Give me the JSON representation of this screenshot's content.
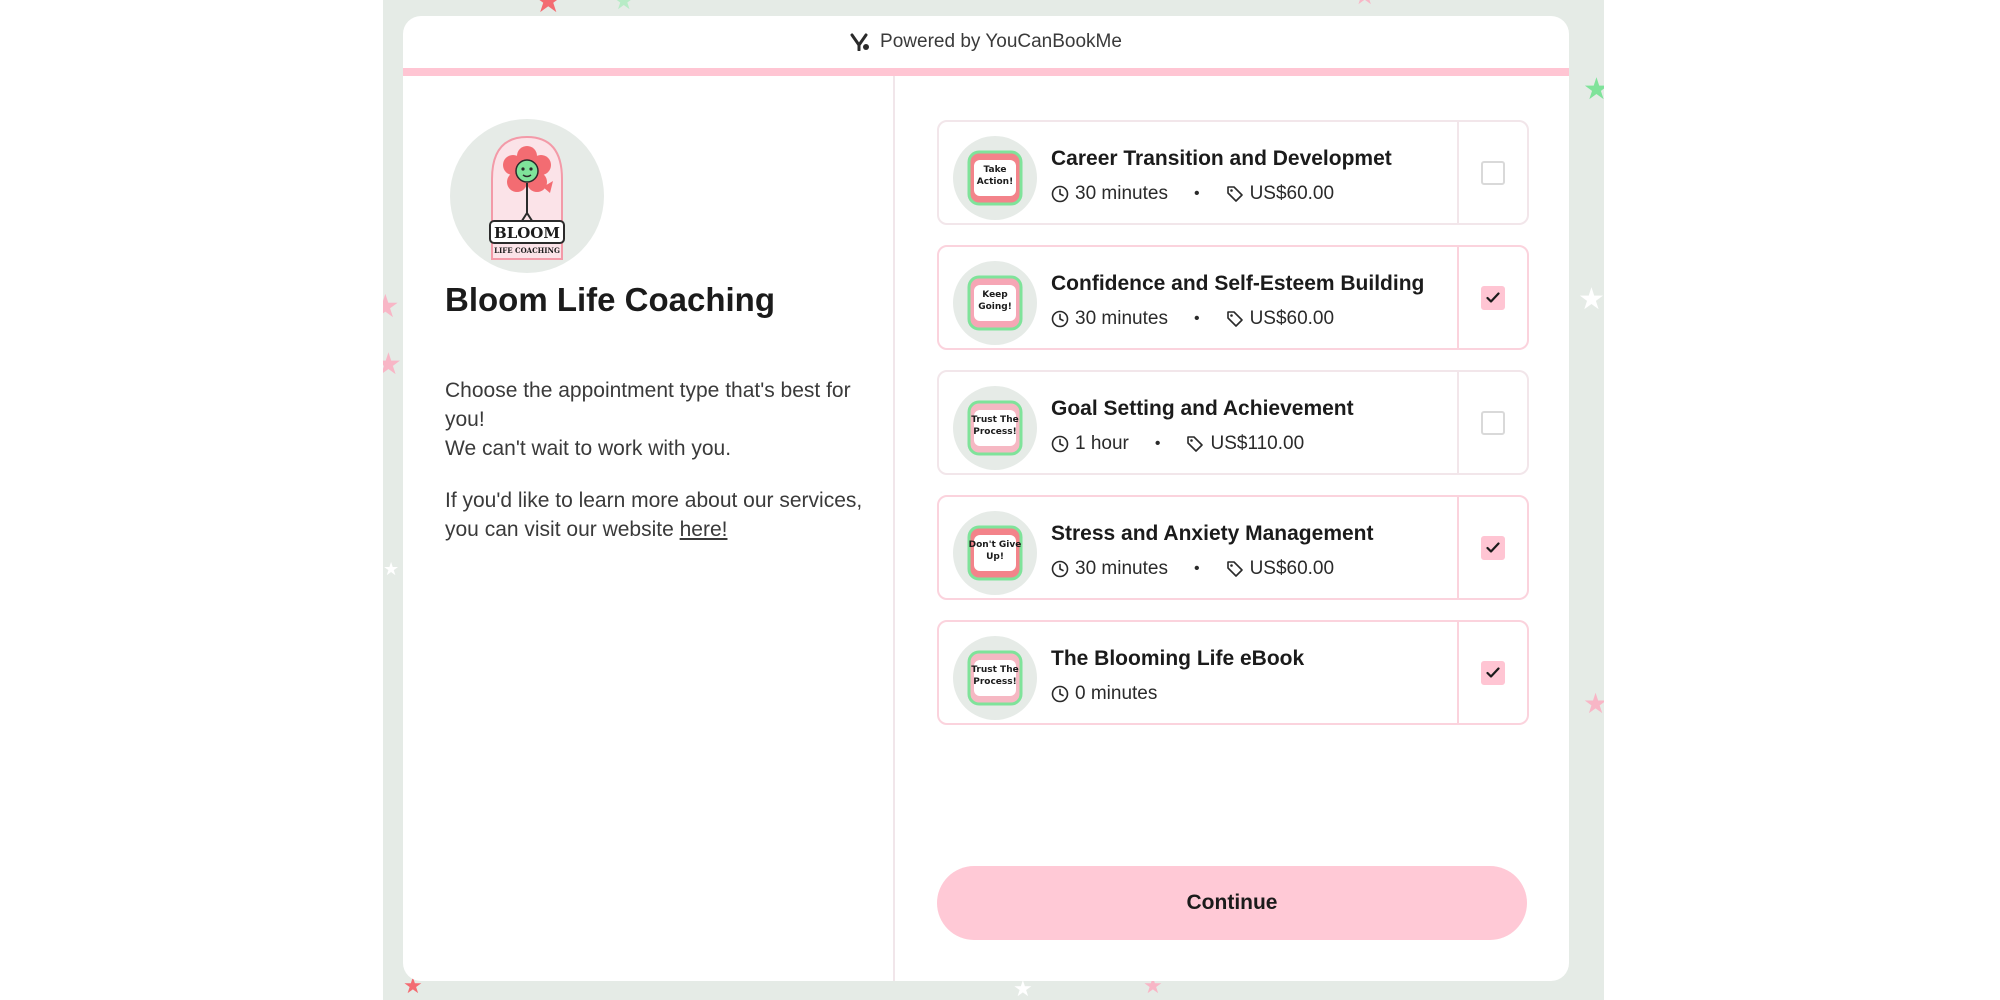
{
  "header": {
    "powered_by": "Powered by YouCanBookMe"
  },
  "profile": {
    "logo_text_main": "BLOOM",
    "logo_text_sub": "LIFE COACHING",
    "name": "Bloom Life Coaching",
    "description_line1": "Choose the appointment type that's best for you!",
    "description_line2": "We can't wait to work with you.",
    "learn_more": "If you'd like to learn more about our services, you can visit our website ",
    "link_text": "here!"
  },
  "services": [
    {
      "title": "Career Transition and Developmet",
      "duration": "30 minutes",
      "price": "US$60.00",
      "selected": false,
      "badge": "Take Action!",
      "badge_color": "#f3838a"
    },
    {
      "title": "Confidence and Self-Esteem Building",
      "duration": "30 minutes",
      "price": "US$60.00",
      "selected": true,
      "badge": "Keep Going!",
      "badge_color": "#f6a6b5"
    },
    {
      "title": "Goal Setting and Achievement",
      "duration": "1 hour",
      "price": "US$110.00",
      "selected": false,
      "badge": "Trust The Process!",
      "badge_color": "#f6b8c3"
    },
    {
      "title": "Stress and Anxiety Management",
      "duration": "30 minutes",
      "price": "US$60.00",
      "selected": true,
      "badge": "Don't Give Up!",
      "badge_color": "#f3838a"
    },
    {
      "title": "The Blooming Life eBook",
      "duration": "0 minutes",
      "price": "",
      "selected": true,
      "badge": "Trust The Process!",
      "badge_color": "#f6b8c3"
    }
  ],
  "actions": {
    "continue_label": "Continue"
  },
  "colors": {
    "accent_pink": "#ffc5d3",
    "background_mint": "#e5ebe6",
    "star_red": "#f36c72",
    "star_green": "#7fe39a"
  }
}
